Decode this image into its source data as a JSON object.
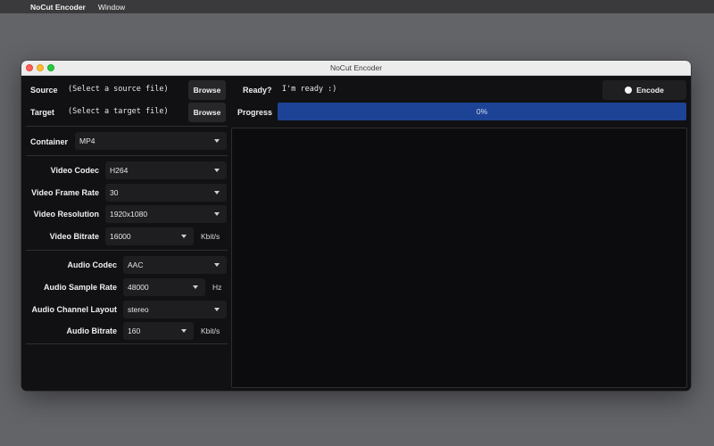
{
  "menubar": {
    "apple_glyph": "",
    "app_name": "NoCut Encoder",
    "items": [
      "Window"
    ]
  },
  "window": {
    "title": "NoCut Encoder"
  },
  "source": {
    "label": "Source",
    "placeholder": "(Select a source file)",
    "browse_label": "Browse"
  },
  "target": {
    "label": "Target",
    "placeholder": "(Select a target file)",
    "browse_label": "Browse"
  },
  "status": {
    "label": "Ready?",
    "value": "I'm ready :)"
  },
  "encode_button": {
    "label": "Encode",
    "icon": "record-dot-icon"
  },
  "progress": {
    "label": "Progress",
    "text": "0%",
    "fraction": 0
  },
  "container": {
    "label": "Container",
    "value": "MP4"
  },
  "video": {
    "codec_label": "Video Codec",
    "codec_value": "H264",
    "frame_rate_label": "Video Frame Rate",
    "frame_rate_value": "30",
    "resolution_label": "Video Resolution",
    "resolution_value": "1920x1080",
    "bitrate_label": "Video Bitrate",
    "bitrate_value": "16000",
    "bitrate_unit": "Kbit/s"
  },
  "audio": {
    "codec_label": "Audio Codec",
    "codec_value": "AAC",
    "sample_rate_label": "Audio Sample Rate",
    "sample_rate_value": "48000",
    "sample_rate_unit": "Hz",
    "channel_layout_label": "Audio Channel Layout",
    "channel_layout_value": "stereo",
    "bitrate_label": "Audio Bitrate",
    "bitrate_value": "160",
    "bitrate_unit": "Kbit/s"
  },
  "colors": {
    "progress_fill": "#1d4396",
    "window_bg": "#111113",
    "desktop_bg": "#636468"
  }
}
